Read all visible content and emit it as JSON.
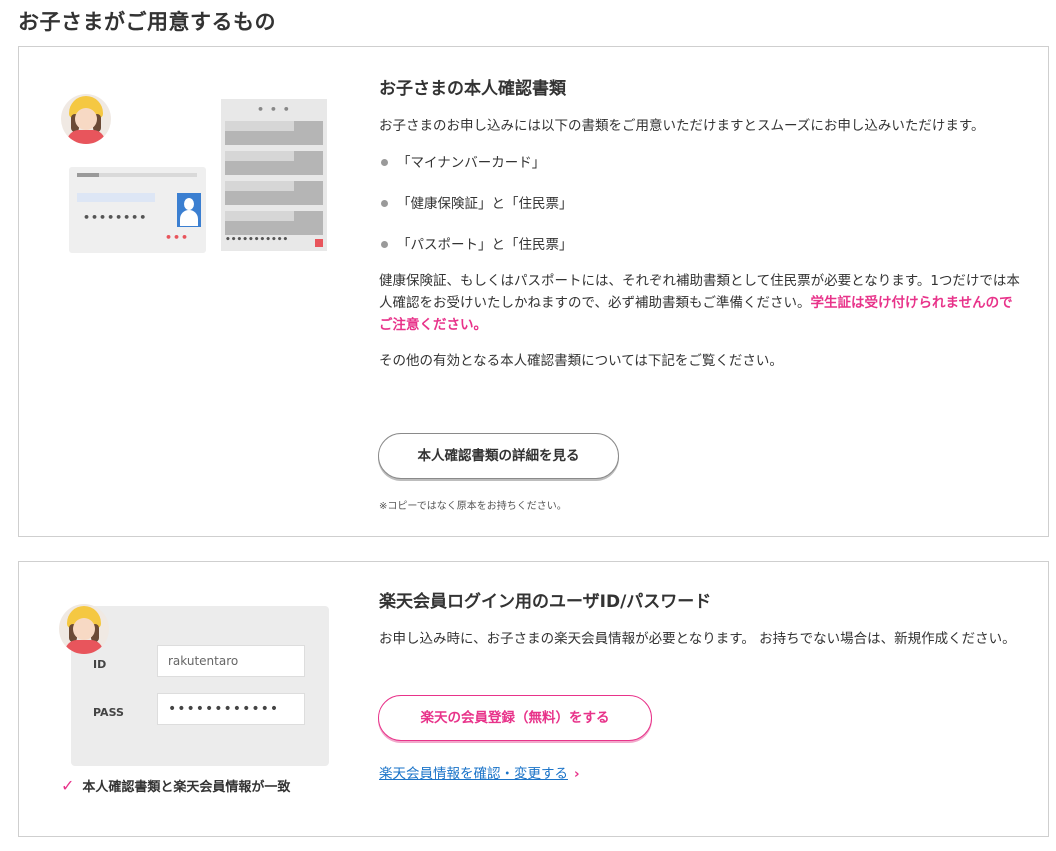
{
  "page": {
    "title": "お子さまがご用意するもの"
  },
  "colors": {
    "accent": "#e8338a",
    "link": "#1a73c8",
    "border": "#cfcfcf"
  },
  "id_section": {
    "title": "お子さまの本人確認書類",
    "intro": "お子さまのお申し込みには以下の書類をご用意いただけますとスムーズにお申し込みいただけます。",
    "documents": [
      "「マイナンバーカード」",
      "「健康保険証」と「住民票」",
      "「パスポート」と「住民票」"
    ],
    "note_text": "健康保険証、もしくはパスポートには、それぞれ補助書類として住民票が必要となります。1つだけでは本人確認をお受けいたしかねますので、必ず補助書類もご準備ください。",
    "alert": "学生証は受け付けられませんのでご注意ください。",
    "other_text": "その他の有効となる本人確認書類については下記をご覧ください。",
    "button_label": "本人確認書類の詳細を見る",
    "footnote": "※コピーではなく原本をお持ちください。",
    "illustration": {
      "card_dots": "••••••••",
      "card_red_dots": "•••",
      "doc_dots_top": "• • •",
      "doc_dots_bottom": "•••••••••••",
      "icons": [
        "child-avatar-icon",
        "id-card-icon",
        "document-icon"
      ]
    }
  },
  "login_section": {
    "title": "楽天会員ログイン用のユーザID/パスワード",
    "text": "お申し込み時に、お子さまの楽天会員情報が必要となります。 お持ちでない場合は、新規作成ください。",
    "register_button": "楽天の会員登録（無料）をする",
    "link_label": "楽天会員情報を確認・変更する",
    "illustration": {
      "id_label": "ID",
      "id_value": "rakutentaro",
      "pass_label": "PASS",
      "pass_value": "••••••••••••",
      "check_text": "本人確認書類と楽天会員情報が一致",
      "icons": [
        "child-avatar-icon",
        "check-icon",
        "chevron-right-icon"
      ]
    }
  }
}
